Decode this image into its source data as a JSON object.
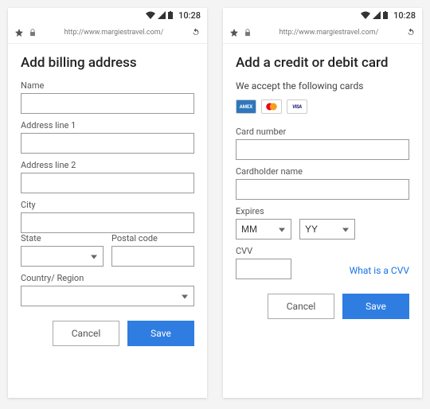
{
  "status": {
    "time": "10:28"
  },
  "url": "http://www.margiestravel.com/",
  "left": {
    "title": "Add billing address",
    "labels": {
      "name": "Name",
      "addr1": "Address line 1",
      "addr2": "Address line 2",
      "city": "City",
      "state": "State",
      "postal": "Postal code",
      "country": "Country/ Region"
    },
    "buttons": {
      "cancel": "Cancel",
      "save": "Save"
    }
  },
  "right": {
    "title": "Add a credit or debit card",
    "subtext": "We accept the following cards",
    "cards": {
      "amex": "AMEX",
      "visa": "VISA"
    },
    "labels": {
      "cardnum": "Card number",
      "holder": "Cardholder name",
      "expires": "Expires",
      "mm": "MM",
      "yy": "YY",
      "cvv": "CVV"
    },
    "link_cvv": "What is a CVV",
    "buttons": {
      "cancel": "Cancel",
      "save": "Save"
    }
  }
}
